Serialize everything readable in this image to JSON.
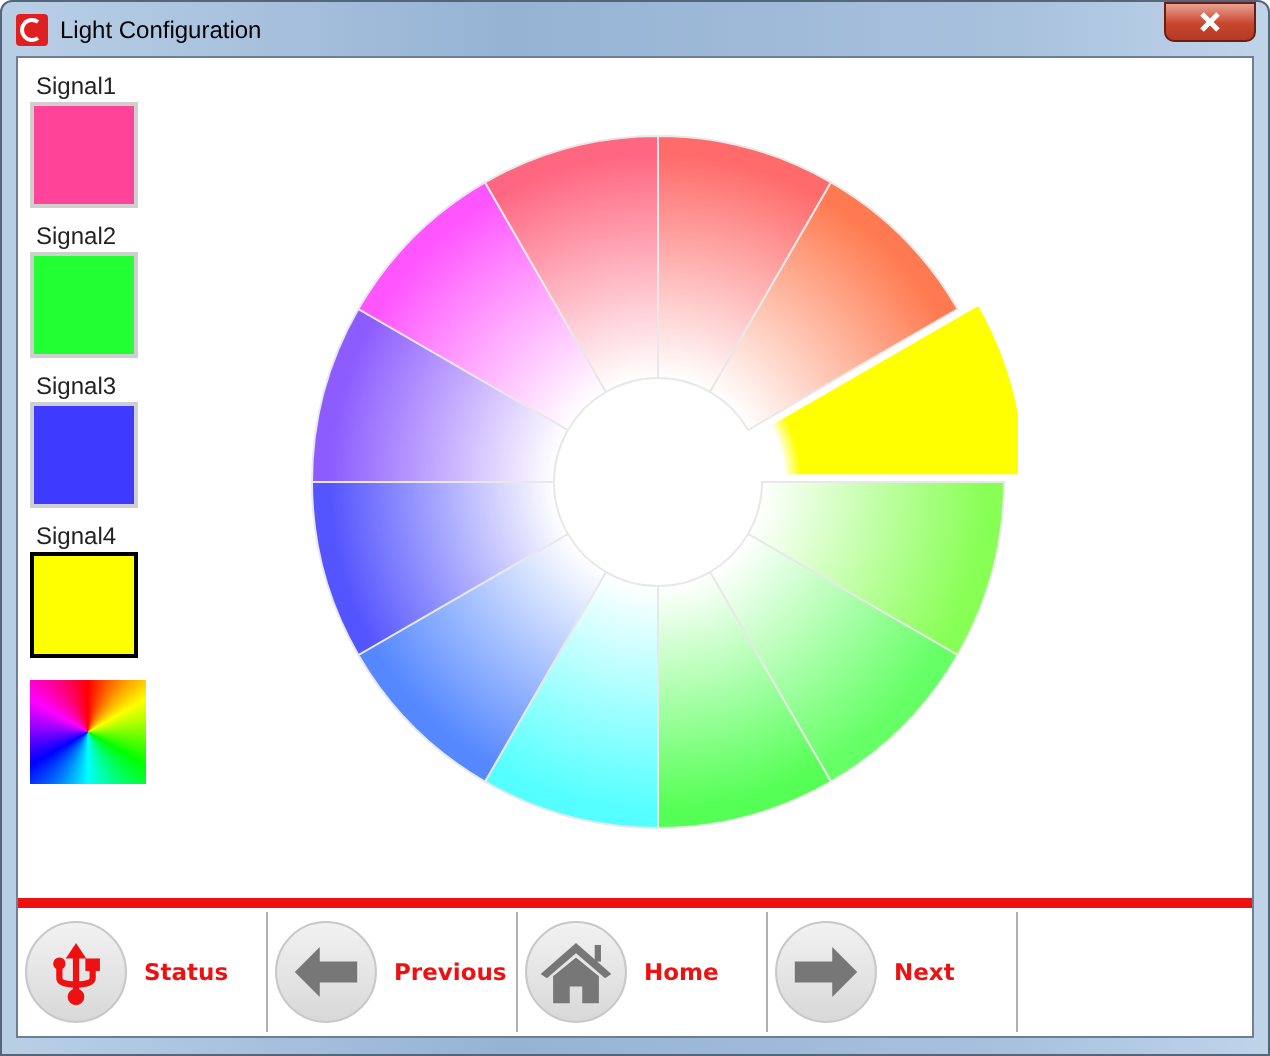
{
  "window": {
    "title": "Light Configuration"
  },
  "signals": [
    {
      "name": "Signal1",
      "color": "#ff4499",
      "selected": false
    },
    {
      "name": "Signal2",
      "color": "#22ff33",
      "selected": false
    },
    {
      "name": "Signal3",
      "color": "#3f3aff",
      "selected": false
    },
    {
      "name": "Signal4",
      "color": "#ffff00",
      "selected": true
    }
  ],
  "wheel": {
    "segments": [
      {
        "color": "#ff6a6a",
        "selected": false
      },
      {
        "color": "#ff7a50",
        "selected": false
      },
      {
        "color": "#ffff00",
        "selected": true
      },
      {
        "color": "#88ff55",
        "selected": false
      },
      {
        "color": "#66ff66",
        "selected": false
      },
      {
        "color": "#55ff55",
        "selected": false
      },
      {
        "color": "#55ffff",
        "selected": false
      },
      {
        "color": "#5588ff",
        "selected": false
      },
      {
        "color": "#5555ff",
        "selected": false
      },
      {
        "color": "#8c5cff",
        "selected": false
      },
      {
        "color": "#ff55ff",
        "selected": false
      },
      {
        "color": "#ff6680",
        "selected": false
      }
    ]
  },
  "toolbar": [
    {
      "kind": "usb",
      "label": "Status"
    },
    {
      "kind": "back",
      "label": "Previous"
    },
    {
      "kind": "home",
      "label": "Home"
    },
    {
      "kind": "forward",
      "label": "Next"
    }
  ]
}
